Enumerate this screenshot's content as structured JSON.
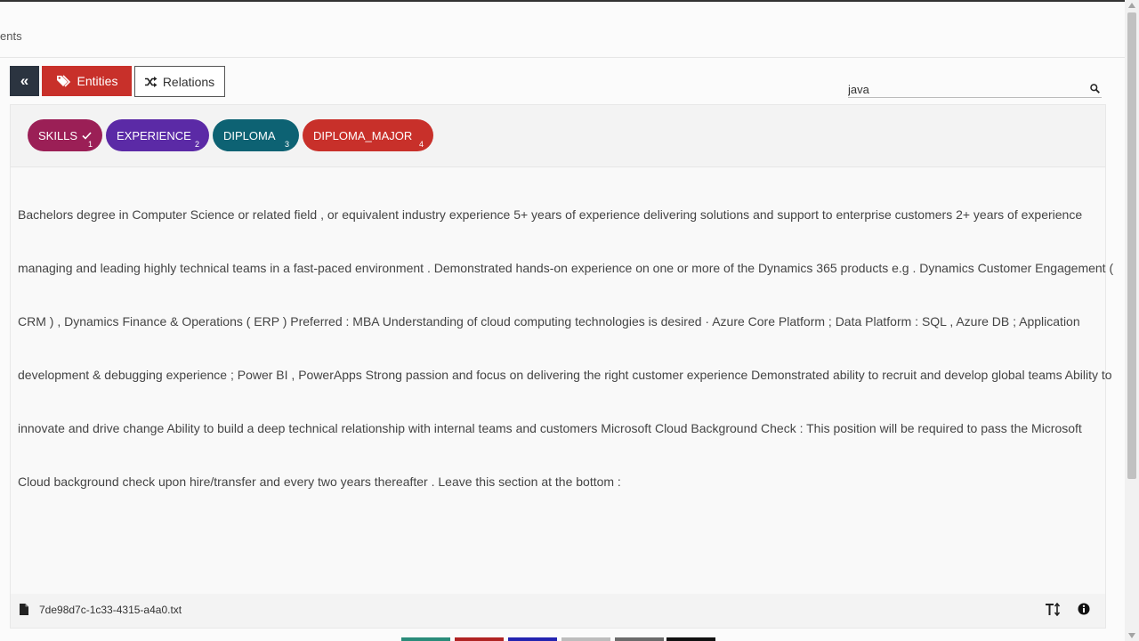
{
  "breadcrumb": "ents",
  "toolbar": {
    "collapse_label": "«",
    "entities_label": "Entities",
    "relations_label": "Relations"
  },
  "search": {
    "value": "java"
  },
  "tags": [
    {
      "label": "SKILLS",
      "number": "1",
      "color": "#9b1f56",
      "checked": true
    },
    {
      "label": "EXPERIENCE",
      "number": "2",
      "color": "#5b2aa6"
    },
    {
      "label": "DIPLOMA",
      "number": "3",
      "color": "#0d6273"
    },
    {
      "label": "DIPLOMA_MAJOR",
      "number": "4",
      "color": "#c8302a"
    }
  ],
  "document": {
    "lines": [
      "Bachelors degree in Computer Science or related field , or equivalent industry experience 5+ years of experience delivering solutions and support to enterprise customers 2+ years of experience",
      "managing and leading highly technical teams in a fast-paced environment . Demonstrated hands-on experience on one or more of the Dynamics 365 products e.g . Dynamics Customer Engagement (",
      "CRM ) , Dynamics Finance & Operations ( ERP ) Preferred : MBA Understanding of cloud computing technologies is desired · Azure Core Platform ; Data Platform : SQL , Azure DB ; Application",
      "development & debugging experience ; Power BI , PowerApps Strong passion and focus on delivering the right customer experience Demonstrated ability to recruit and develop global teams Ability to",
      "innovate and drive change Ability to build a deep technical relationship with internal teams and customers Microsoft Cloud Background Check : This position will be required to pass the Microsoft",
      "Cloud background check upon hire/transfer and every two years thereafter . Leave this section at the bottom :"
    ]
  },
  "footer": {
    "file_name": "7de98d7c-1c33-4315-a4a0.txt"
  },
  "colors": {
    "accent": "#c8302a",
    "dark": "#2b3440",
    "swatches": [
      "#2a8c7a",
      "#b02323",
      "#2323b0",
      "#bdbdbd",
      "#6b6b6b",
      "#111111"
    ]
  }
}
